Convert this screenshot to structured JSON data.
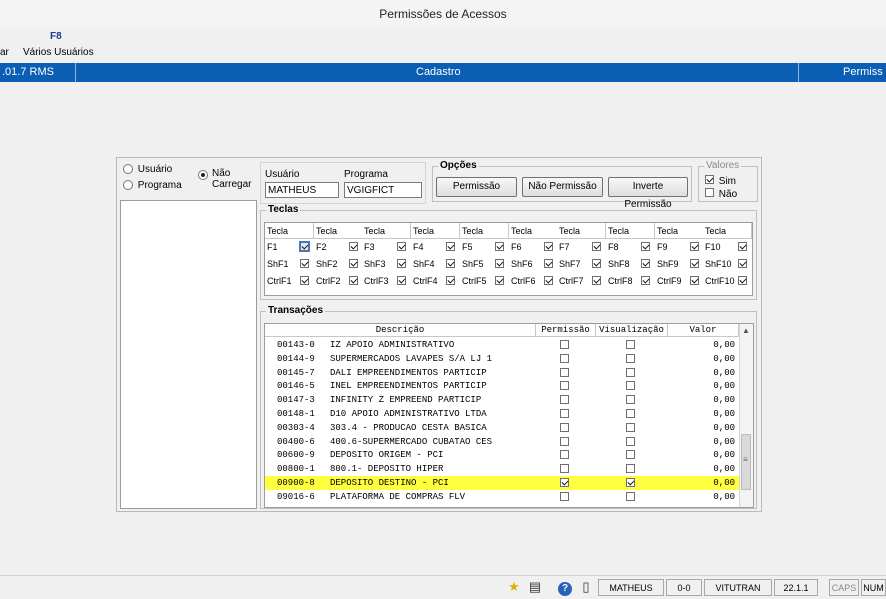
{
  "window": {
    "title": "Permissões de Acessos"
  },
  "toolbar": {
    "key": "F8",
    "item_partial": "ar",
    "item": "Vários Usuários"
  },
  "header": {
    "left": ".01.7 RMS",
    "center": "Cadastro",
    "right": "Permiss"
  },
  "radios": {
    "usuario": "Usuário",
    "programa": "Programa",
    "nao_carregar": "Não Carregar"
  },
  "fields": {
    "usuario_label": "Usuário",
    "usuario_value": "MATHEUS",
    "programa_label": "Programa",
    "programa_value": "VGIGFICT"
  },
  "opcoes": {
    "title": "Opções",
    "permissao": "Permissão",
    "nao_permissao": "Não Permissão",
    "inverte_permissao": "Inverte Permissão"
  },
  "valores": {
    "title": "Valores",
    "sim": "Sim",
    "nao": "Não",
    "sim_checked": true,
    "nao_checked": false
  },
  "teclas": {
    "title": "Teclas",
    "header": "Tecla",
    "rows": [
      [
        "F1",
        "F2",
        "F3",
        "F4",
        "F5",
        "F6",
        "F7",
        "F8",
        "F9",
        "F10"
      ],
      [
        "ShF1",
        "ShF2",
        "ShF3",
        "ShF4",
        "ShF5",
        "ShF6",
        "ShF7",
        "ShF8",
        "ShF9",
        "ShF10"
      ],
      [
        "CtrlF1",
        "CtrlF2",
        "CtrlF3",
        "CtrlF4",
        "CtrlF5",
        "CtrlF6",
        "CtrlF7",
        "CtrlF8",
        "CtrlF9",
        "CtrlF10"
      ]
    ]
  },
  "transacoes": {
    "title": "Transações",
    "columns": [
      "Descrição",
      "Permissão",
      "Visualização",
      "Valor"
    ],
    "rows": [
      {
        "code": "00143-0",
        "desc": "IZ APOIO ADMINISTRATIVO",
        "perm": false,
        "vis": false,
        "valor": "0,00"
      },
      {
        "code": "00144-9",
        "desc": "SUPERMERCADOS LAVAPES S/A LJ 1",
        "perm": false,
        "vis": false,
        "valor": "0,00"
      },
      {
        "code": "00145-7",
        "desc": "DALI EMPREENDIMENTOS PARTICIP",
        "perm": false,
        "vis": false,
        "valor": "0,00"
      },
      {
        "code": "00146-5",
        "desc": "INEL EMPREENDIMENTOS PARTICIP",
        "perm": false,
        "vis": false,
        "valor": "0,00"
      },
      {
        "code": "00147-3",
        "desc": "INFINITY Z EMPREEND PARTICIP",
        "perm": false,
        "vis": false,
        "valor": "0,00"
      },
      {
        "code": "00148-1",
        "desc": "D10 APOIO ADMINISTRATIVO LTDA",
        "perm": false,
        "vis": false,
        "valor": "0,00"
      },
      {
        "code": "00303-4",
        "desc": "303.4 - PRODUCAO CESTA BASICA",
        "perm": false,
        "vis": false,
        "valor": "0,00"
      },
      {
        "code": "00400-6",
        "desc": "400.6-SUPERMERCADO CUBATAO CES",
        "perm": false,
        "vis": false,
        "valor": "0,00"
      },
      {
        "code": "00600-9",
        "desc": "DEPOSITO ORIGEM - PCI",
        "perm": false,
        "vis": false,
        "valor": "0,00"
      },
      {
        "code": "00800-1",
        "desc": "800.1- DEPOSITO HIPER",
        "perm": false,
        "vis": false,
        "valor": "0,00"
      },
      {
        "code": "00900-8",
        "desc": "DEPOSITO DESTINO - PCI",
        "perm": true,
        "vis": true,
        "valor": "0,00",
        "highlight": true
      },
      {
        "code": "09016-6",
        "desc": "PLATAFORMA DE COMPRAS FLV",
        "perm": false,
        "vis": false,
        "valor": "0,00"
      }
    ]
  },
  "status": {
    "user": "MATHEUS",
    "code": "0-0",
    "company": "VITUTRAN",
    "version": "22.1.1",
    "caps": "CAPS",
    "num": "NUM"
  },
  "colors": {
    "accent": "#0a5fb4",
    "highlight": "#ffff40"
  }
}
